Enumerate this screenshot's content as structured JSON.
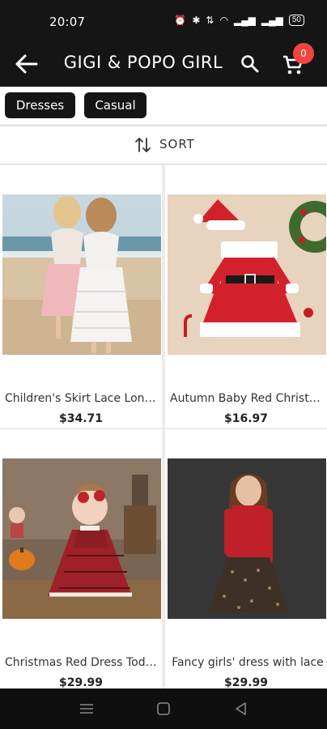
{
  "status": {
    "time": "20:07",
    "battery": "50"
  },
  "appbar": {
    "title": "GIGI & POPO GIRL",
    "cart_count": "0"
  },
  "filters": [
    {
      "label": "Dresses"
    },
    {
      "label": "Casual"
    }
  ],
  "sort": {
    "label": "SORT"
  },
  "products": [
    {
      "name": "Children's Skirt Lace Long Dress",
      "price": "$34.71",
      "image": "two girls in lace dresses on beach"
    },
    {
      "name": "Autumn Baby Red Christmas Dress",
      "price": "$16.97",
      "image": "red santa dress with hat flat lay"
    },
    {
      "name": "Christmas Red Dress Toddler",
      "price": "$29.99",
      "image": "toddler in red plaid dress"
    },
    {
      "name": "Fancy girls' dress with lace",
      "price": "$29.99",
      "image": "girl in red top and sequin skirt"
    }
  ],
  "colors": {
    "bar": "#151515",
    "badge": "#f2453d"
  }
}
